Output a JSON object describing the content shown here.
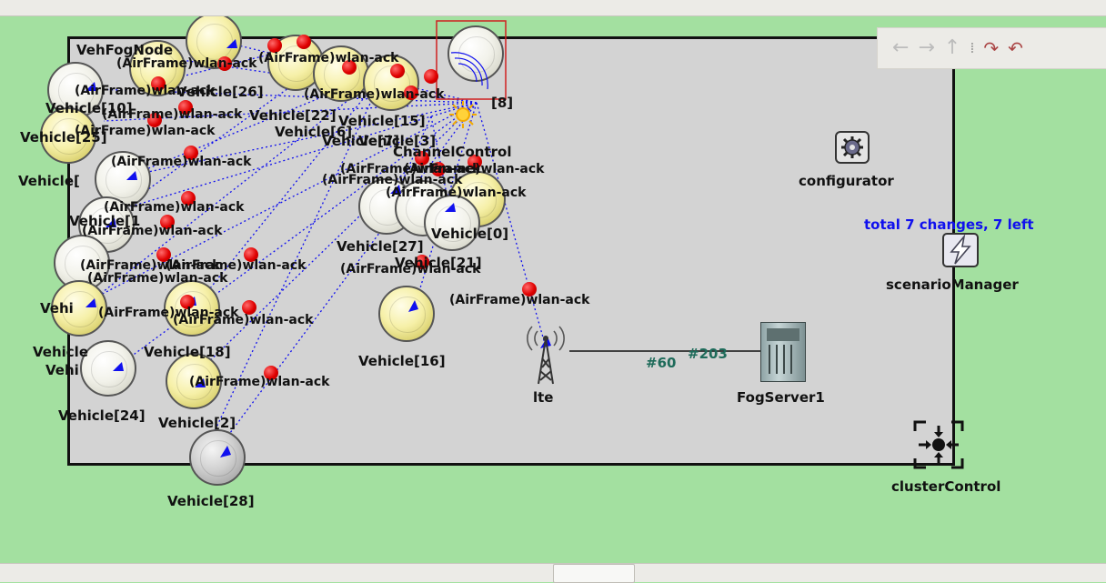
{
  "canvas": {
    "background": "#a3e0a0",
    "playground_background": "#d3d3d3"
  },
  "toolbar": {
    "back_icon": "arrow-left-icon",
    "forward_icon": "arrow-right-icon",
    "up_icon": "arrow-up-icon",
    "rotate_left_icon": "rotate-left-icon",
    "rotate_right_icon": "rotate-right-icon"
  },
  "modules": {
    "configurator": "configurator",
    "scenario_manager": "scenarioManager",
    "scenario_info": "total 7 changes, 7 left",
    "lte": "lte",
    "fog_server": "FogServer1",
    "cluster_control": "clusterControl",
    "channel_control": "ChannelControl",
    "fog_node": "VehFogNode"
  },
  "links": {
    "lte_gate": "#60",
    "server_gate": "#203"
  },
  "vehicles": {
    "v16": "Vehicle[16]",
    "v18": "Vehicle[18]",
    "v24": "Vehicle[24]",
    "v2": "Vehicle[2]",
    "v28": "Vehicle[28]",
    "v27": "Vehicle[27]",
    "v21": "Vehicle[21]",
    "v0": "Vehicle[0]",
    "v8": "[8]",
    "v25": "Vehicle[25]",
    "v1": "Vehicle[1",
    "v_left1": "Vehicle[",
    "v_left2": "Vehicle",
    "v_left3": "Vehi",
    "v_mid1": "Vehicle[6]",
    "v_mid2": "Vehicle[15]",
    "v_mid3": "Vehicle[7]",
    "v_mid4": "Vehicle[3]",
    "v_mid5": "Vehicle[26]",
    "v_mid6": "Vehicle[22]",
    "v_mid7": "Vehicle[10]"
  },
  "messages": {
    "m1": "(AirFrame)wlan-ack",
    "m2": "(AirFrame)wlan-ack",
    "m3": "(AirFrame)wlan-ack",
    "m4": "(AirFrame)wlan-ack",
    "m5": "(AirFrame)wlan-ack",
    "m6": "(AirFrame)wlan-ack",
    "m7": "(AirFrame)wlan-ack",
    "m8": "(AirFrame)wlan-ack",
    "m9": "(AirFrame)wlan-ack",
    "m10": "(AirFrame)wlan-ack",
    "m11": "(AirFrame)wlan-ack",
    "m12": "(AirFrame)wlan-ack",
    "m13": "(AirFrame)wlan-ack",
    "m14": "(AirFrame)wlan-ack",
    "m15": "(AirFrame)wlan-ack",
    "m16": "(AirFrame)wlan-ack",
    "m17": "(AirFrame)wlan-ack",
    "m18": "(AirFrame)wlan-ack",
    "m19": "(AirFrame)wlan-ack",
    "m20": "(AirFrame)wlan-ack",
    "m21": "(AirFrame)wlan-ack"
  },
  "colors": {
    "message_dot": "#e00000",
    "link_line": "#1010ee",
    "info_text": "#1010ee",
    "channel_text": "#1e6b5a",
    "selection_box": "#d02020"
  }
}
